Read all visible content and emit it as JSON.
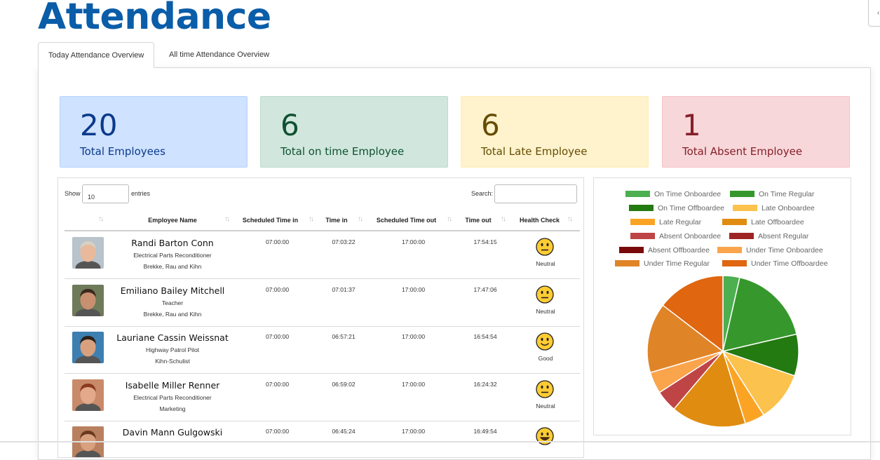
{
  "page": {
    "title": "Attendance"
  },
  "tabs": [
    {
      "label": "Today Attendance Overview",
      "active": true
    },
    {
      "label": "All time Attendance Overview",
      "active": false
    }
  ],
  "stats": [
    {
      "value": "20",
      "label": "Total Employees",
      "bg": "#cfe2ff",
      "border": "#b6d4fe",
      "color": "#0a3a8c"
    },
    {
      "value": "6",
      "label": "Total on time Employee",
      "bg": "#d1e7dd",
      "border": "#badbcc",
      "color": "#0f5132"
    },
    {
      "value": "6",
      "label": "Total Late Employee",
      "bg": "#fff3cd",
      "border": "#ffecb5",
      "color": "#664d03"
    },
    {
      "value": "1",
      "label": "Total Absent Employee",
      "bg": "#f8d7da",
      "border": "#f5c2c7",
      "color": "#842029"
    }
  ],
  "table": {
    "show_label": "Show",
    "page_size": "10",
    "entries_label": "entries",
    "search_label": "Search:",
    "columns": [
      "Employee Name",
      "Scheduled Time in",
      "Time in",
      "Scheduled Time out",
      "Time out",
      "Health Check"
    ],
    "rows": [
      {
        "name": "Randi Barton Conn",
        "job": "Electrical Parts Reconditioner",
        "company": "Brekke, Rau and Kihn",
        "sched_in": "07:00:00",
        "time_in": "07:03:22",
        "sched_out": "17:00:00",
        "time_out": "17:54:15",
        "health": "Neutral",
        "face": "neutral",
        "avatar": {
          "skin": "#e8b99a",
          "hair": "#d8d0c4",
          "bg": "#b9c3cc"
        }
      },
      {
        "name": "Emiliano Bailey Mitchell",
        "job": "Teacher",
        "company": "Brekke, Rau and Kihn",
        "sched_in": "07:00:00",
        "time_in": "07:01:37",
        "sched_out": "17:00:00",
        "time_out": "17:47:06",
        "health": "Neutral",
        "face": "neutral",
        "avatar": {
          "skin": "#c89070",
          "hair": "#3a2a1e",
          "bg": "#6f7a5a"
        }
      },
      {
        "name": "Lauriane Cassin Weissnat",
        "job": "Highway Patrol Pilot",
        "company": "Kihn-Schulist",
        "sched_in": "07:00:00",
        "time_in": "06:57:21",
        "sched_out": "17:00:00",
        "time_out": "16:54:54",
        "health": "Good",
        "face": "good",
        "avatar": {
          "skin": "#d9a07e",
          "hair": "#2a2018",
          "bg": "#3d7fb0"
        }
      },
      {
        "name": "Isabelle Miller Renner",
        "job": "Electrical Parts Reconditioner",
        "company": "Marketing",
        "sched_in": "07:00:00",
        "time_in": "06:59:02",
        "sched_out": "17:00:00",
        "time_out": "16:24:32",
        "health": "Neutral",
        "face": "neutral",
        "avatar": {
          "skin": "#e2a98a",
          "hair": "#8a3a1e",
          "bg": "#c98a6a"
        }
      },
      {
        "name": "Davin Mann Gulgowski",
        "job": "",
        "company": "",
        "sched_in": "07:00:00",
        "time_in": "06:45:24",
        "sched_out": "17:00:00",
        "time_out": "16:49:54",
        "health": "",
        "face": "happy",
        "avatar": {
          "skin": "#d9a07e",
          "hair": "#6a3a20",
          "bg": "#b98060"
        }
      }
    ]
  },
  "chart_data": {
    "type": "pie",
    "series": [
      {
        "name": "On Time Onboardee",
        "value": 1,
        "color": "#4caf50"
      },
      {
        "name": "On Time Regular",
        "value": 5,
        "color": "#36982c"
      },
      {
        "name": "On Time Offboardee",
        "value": 2.5,
        "color": "#237a10"
      },
      {
        "name": "Late Onboardee",
        "value": 3,
        "color": "#fcc24e"
      },
      {
        "name": "Late Regular",
        "value": 1.2,
        "color": "#fba424"
      },
      {
        "name": "Late Offboardee",
        "value": 4.5,
        "color": "#e08c10"
      },
      {
        "name": "Absent Onboardee",
        "value": 1.3,
        "color": "#bf4446"
      },
      {
        "name": "Absent Regular",
        "value": 0,
        "color": "#9e2424"
      },
      {
        "name": "Absent Offboardee",
        "value": 0,
        "color": "#7a0a0a"
      },
      {
        "name": "Under Time Onboardee",
        "value": 1.3,
        "color": "#faa44c"
      },
      {
        "name": "Under Time Regular",
        "value": 4.2,
        "color": "#e08428"
      },
      {
        "name": "Under Time Offboardee",
        "value": 4.1,
        "color": "#e06610"
      }
    ],
    "legend_position": "top"
  }
}
